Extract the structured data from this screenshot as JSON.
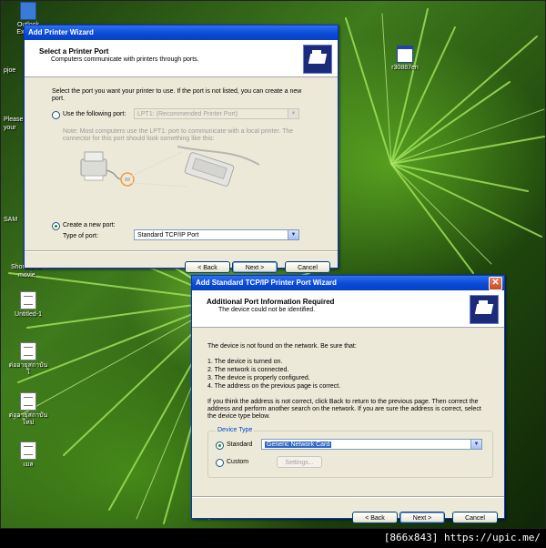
{
  "desktop": {
    "icons": [
      {
        "label": "Outlook Express"
      },
      {
        "label": "r30887en"
      },
      {
        "label": "Untitled-1"
      },
      {
        "label": "ต่ออายุสถาบันใ"
      },
      {
        "label": "ต่ออายุสถาบันใหม่"
      },
      {
        "label": "เมล"
      }
    ],
    "partial_labels": [
      "pjoe",
      "Please",
      "your",
      "SAM",
      "Shortcut to",
      "movie"
    ]
  },
  "add_printer_wizard": {
    "title": "Add Printer Wizard",
    "header_title": "Select a Printer Port",
    "header_subtitle": "Computers communicate with printers through ports.",
    "intro": "Select the port you want your printer to use.  If the port is not listed, you can create a new port.",
    "use_port_label": "Use the following port:",
    "port_value": "LPT1: (Recommended Printer Port)",
    "note": "Note: Most computers use the LPT1: port to communicate with a local printer. The connector for this port should look something like this:",
    "create_port_label": "Create a new port:",
    "type_of_port_label": "Type of port:",
    "type_of_port_value": "Standard TCP/IP Port",
    "back_label": "< Back",
    "next_label": "Next >",
    "cancel_label": "Cancel",
    "selected_option": "create_new_port"
  },
  "tcpip_wizard": {
    "title": "Add Standard TCP/IP Printer Port Wizard",
    "header_title": "Additional Port Information Required",
    "header_subtitle": "The device could not be identified.",
    "intro": "The device is not found on the network.  Be sure that:",
    "checklist": [
      "1.  The device is turned on.",
      "2.  The network is connected.",
      "3.  The device is properly configured.",
      "4.  The address on the previous page is correct."
    ],
    "instructions": "If you think the address is not correct, click Back to return to the previous page.  Then correct the address and perform another search on the network.  If you are sure the address is correct, select the device type below.",
    "device_type_legend": "Device Type",
    "standard_label": "Standard",
    "standard_value": "Generic Network Card",
    "custom_label": "Custom",
    "settings_label": "Settings...",
    "back_label": "< Back",
    "next_label": "Next >",
    "cancel_label": "Cancel",
    "selected_option": "standard"
  },
  "watermark": "[866x843] https://upic.me/"
}
